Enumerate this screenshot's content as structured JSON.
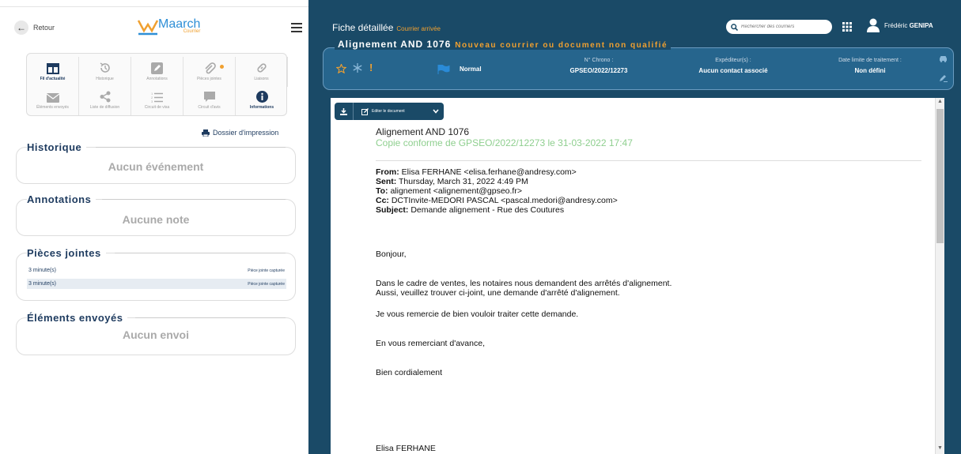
{
  "left": {
    "back_label": "Retour",
    "logo": {
      "name": "Maarch",
      "sub": "Courrier"
    },
    "tools": [
      {
        "label": "Fil d'actualité",
        "icon": "newspaper-icon",
        "active": true
      },
      {
        "label": "Historique",
        "icon": "history-icon",
        "active": false
      },
      {
        "label": "Annotations",
        "icon": "annotation-icon",
        "active": false
      },
      {
        "label": "Pièces jointes",
        "icon": "paperclip-icon",
        "active": false
      },
      {
        "label": "Liaisons",
        "icon": "link-icon",
        "active": false
      },
      {
        "label": "Éléments envoyés",
        "icon": "mail-icon",
        "active": false
      },
      {
        "label": "Liste de diffusion",
        "icon": "share-icon",
        "active": false
      },
      {
        "label": "Circuit de visa",
        "icon": "list-icon",
        "active": false
      },
      {
        "label": "Circuit d'avis",
        "icon": "comment-icon",
        "active": false
      },
      {
        "label": "Informations",
        "icon": "info-icon",
        "active": true
      }
    ],
    "print_label": "Dossier d'impression",
    "sections": {
      "historique": {
        "title": "Historique",
        "empty": "Aucun événement"
      },
      "annotations": {
        "title": "Annotations",
        "empty": "Aucune note"
      },
      "pieces": {
        "title": "Pièces jointes",
        "rows": [
          {
            "time": "3 minute(s)",
            "label": "Pièce jointe capturée"
          },
          {
            "time": "3 minute(s)",
            "label": "Pièce jointe capturée"
          }
        ]
      },
      "envoyes": {
        "title": "Éléments envoyés",
        "empty": "Aucun envoi"
      }
    }
  },
  "right": {
    "title": "Fiche détaillée",
    "subtitle": "Courrier arrivée",
    "search_placeholder": "Rechercher des courriers",
    "user_first": "Frédéric",
    "user_last": "GENIPA",
    "mail": {
      "subject": "Alignement AND 1076",
      "status": "Nouveau courrier ou document non qualifié",
      "priority": "Normal",
      "chrono_label": "N° Chrono :",
      "chrono_value": "GPSEO/2022/12273",
      "sender_label": "Expéditeur(s) :",
      "sender_value": "Aucun contact associé",
      "deadline_label": "Date limite de traitement :",
      "deadline_value": "Non défini"
    },
    "toolbar": {
      "edit_label": "Editer le document"
    },
    "document": {
      "subject": "Alignement AND 1076",
      "copy": "Copie conforme de GPSEO/2022/12273 le 31-03-2022 17:47",
      "from_label": "From:",
      "from_value": " Elisa FERHANE <elisa.ferhane@andresy.com>",
      "sent_label": "Sent:",
      "sent_value": " Thursday, March 31, 2022 4:49 PM",
      "to_label": "To:",
      "to_value": " alignement <alignement@gpseo.fr>",
      "cc_label": "Cc:",
      "cc_value": " DCTInvite-MEDORI PASCAL <pascal.medori@andresy.com>",
      "subj_label": "Subject:",
      "subj_value": " Demande alignement - Rue des Coutures",
      "greeting": "Bonjour,",
      "para1": "Dans le cadre de ventes, les notaires nous demandent des arrêtés d'alignement.",
      "para2": "Aussi, veuillez trouver ci-joint, une demande d'arrêté d'alignement.",
      "para3": "Je vous remercie de bien vouloir traiter cette demande.",
      "para4": "En vous remerciant d'avance,",
      "signoff": "Bien cordialement",
      "signature": "Elisa FERHANE"
    }
  }
}
